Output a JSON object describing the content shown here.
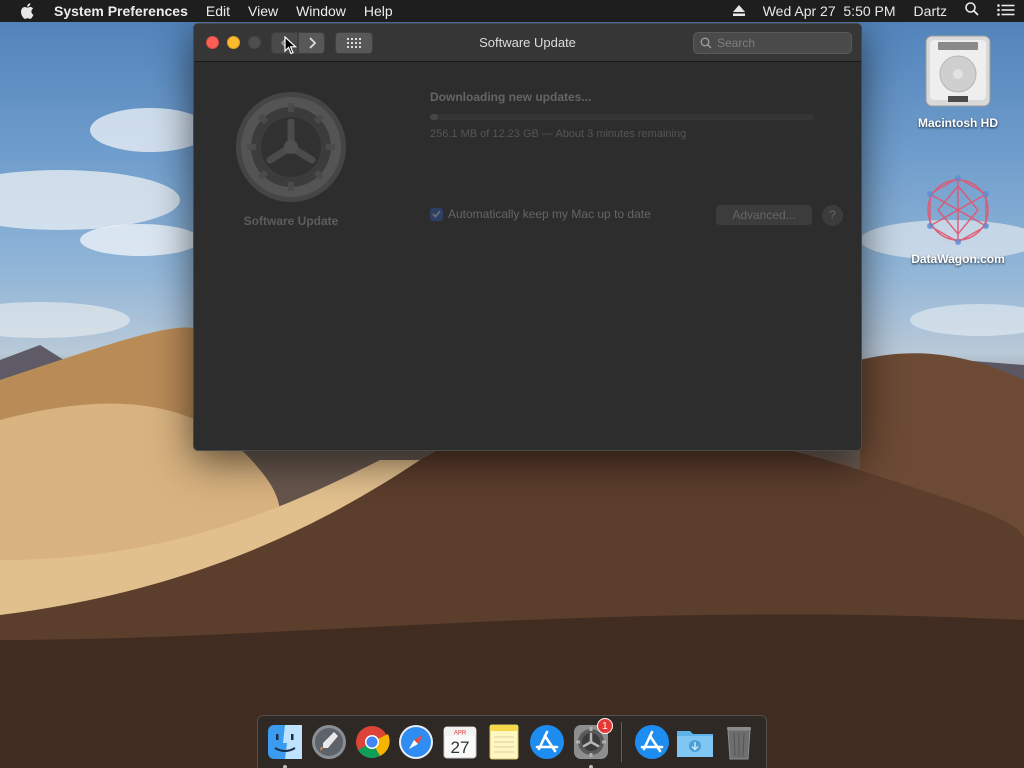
{
  "menubar": {
    "app_name": "System Preferences",
    "menus": [
      "Edit",
      "View",
      "Window",
      "Help"
    ],
    "datetime": "Wed Apr 27  5:50 PM",
    "user": "Dartz"
  },
  "window": {
    "title": "Software Update",
    "search_placeholder": "Search",
    "pref_name": "Software Update",
    "status_title": "Downloading new updates...",
    "status_detail": "256.1 MB of 12.23 GB — About 3 minutes remaining",
    "progress_fraction": 0.02,
    "auto_update_label": "Automatically keep my Mac up to date",
    "auto_update_checked": true,
    "advanced_label": "Advanced...",
    "help_label": "?"
  },
  "desktop_icons": [
    {
      "label": "Macintosh HD",
      "icon": "hard-drive-icon"
    },
    {
      "label": "DataWagon.com",
      "icon": "datawagon-logo-icon"
    }
  ],
  "dock": {
    "apps": [
      {
        "name": "Finder",
        "icon": "finder-icon",
        "running": true
      },
      {
        "name": "Launchpad",
        "icon": "launchpad-icon",
        "running": false
      },
      {
        "name": "Google Chrome",
        "icon": "chrome-icon",
        "running": false
      },
      {
        "name": "Safari",
        "icon": "safari-icon",
        "running": false
      },
      {
        "name": "Calendar",
        "icon": "calendar-icon",
        "running": false,
        "month": "APR",
        "day": "27"
      },
      {
        "name": "Notes",
        "icon": "notes-icon",
        "running": false
      },
      {
        "name": "App Store",
        "icon": "app-store-icon",
        "running": false
      },
      {
        "name": "System Preferences",
        "icon": "system-preferences-icon",
        "running": true,
        "badge": "1"
      },
      {
        "name": "App Store Downloads",
        "icon": "app-store-icon",
        "running": false
      },
      {
        "name": "Downloads",
        "icon": "downloads-folder-icon",
        "running": false
      },
      {
        "name": "Trash",
        "icon": "trash-icon",
        "running": false
      }
    ]
  },
  "colors": {
    "close": "#fc5f57",
    "minimize": "#fdbc2e",
    "accent": "#2f6ad9",
    "badge": "#e53935"
  }
}
